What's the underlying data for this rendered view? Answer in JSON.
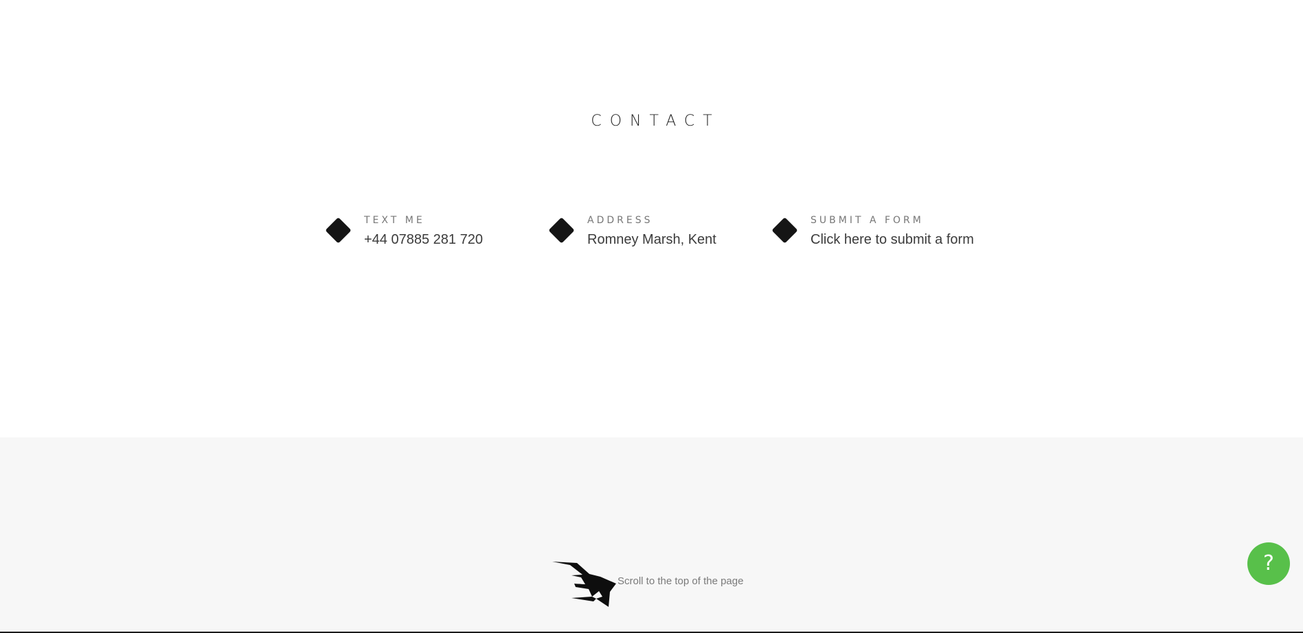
{
  "contact": {
    "title": "CONTACT",
    "items": [
      {
        "label": "TEXT ME",
        "value": "+44 07885 281 720",
        "icon": "diamond-icon"
      },
      {
        "label": "ADDRESS",
        "value": "Romney Marsh, Kent",
        "icon": "diamond-icon"
      },
      {
        "label": "SUBMIT A FORM",
        "value": "Click here to submit a form",
        "icon": "diamond-icon"
      }
    ]
  },
  "footer": {
    "scroll_top_label": "Scroll to the top of the page",
    "logo_icon": "bull-logo-icon"
  },
  "help": {
    "label": "?",
    "color": "#58c04a"
  }
}
